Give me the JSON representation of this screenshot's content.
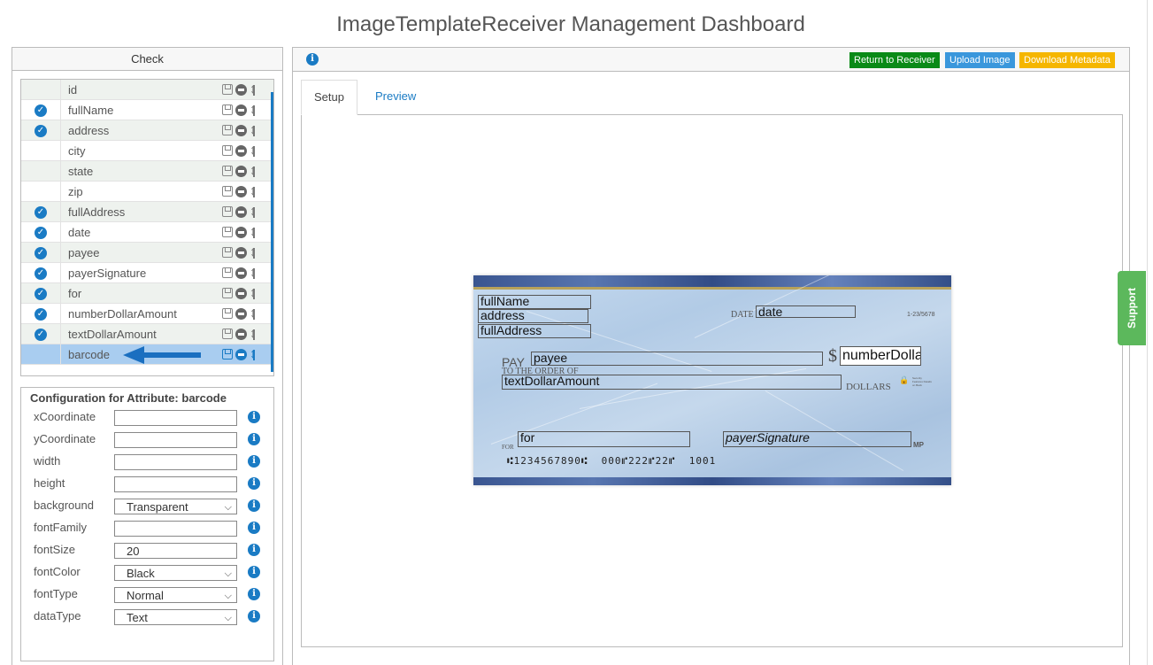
{
  "page": {
    "title": "ImageTemplateReceiver Management Dashboard"
  },
  "left_panel": {
    "header": "Check",
    "attributes": [
      {
        "name": "id",
        "checked": false
      },
      {
        "name": "fullName",
        "checked": true
      },
      {
        "name": "address",
        "checked": true
      },
      {
        "name": "city",
        "checked": false
      },
      {
        "name": "state",
        "checked": false
      },
      {
        "name": "zip",
        "checked": false
      },
      {
        "name": "fullAddress",
        "checked": true
      },
      {
        "name": "date",
        "checked": true
      },
      {
        "name": "payee",
        "checked": true
      },
      {
        "name": "payerSignature",
        "checked": true
      },
      {
        "name": "for",
        "checked": true
      },
      {
        "name": "numberDollarAmount",
        "checked": true
      },
      {
        "name": "textDollarAmount",
        "checked": true
      },
      {
        "name": "barcode",
        "checked": false,
        "selected": true
      }
    ],
    "config": {
      "title": "Configuration for Attribute: barcode",
      "fields": [
        {
          "label": "xCoordinate",
          "type": "input",
          "value": ""
        },
        {
          "label": "yCoordinate",
          "type": "input",
          "value": ""
        },
        {
          "label": "width",
          "type": "input",
          "value": ""
        },
        {
          "label": "height",
          "type": "input",
          "value": ""
        },
        {
          "label": "background",
          "type": "select",
          "value": "Transparent"
        },
        {
          "label": "fontFamily",
          "type": "input",
          "value": ""
        },
        {
          "label": "fontSize",
          "type": "input",
          "value": "20"
        },
        {
          "label": "fontColor",
          "type": "select",
          "value": "Black"
        },
        {
          "label": "fontType",
          "type": "select",
          "value": "Normal"
        },
        {
          "label": "dataType",
          "type": "select",
          "value": "Text"
        }
      ]
    }
  },
  "right_panel": {
    "buttons": {
      "return": "Return to Receiver",
      "upload": "Upload Image",
      "download": "Download Metadata"
    },
    "tabs": [
      {
        "label": "Setup",
        "active": true
      },
      {
        "label": "Preview",
        "active": false
      }
    ],
    "check": {
      "fields": {
        "fullName": "fullName",
        "address": "address",
        "fullAddress": "fullAddress",
        "date": "date",
        "payee": "payee",
        "numberDollarAmount": "numberDollarAmount",
        "textDollarAmount": "textDollarAmount",
        "for": "for",
        "payerSignature": "payerSignature"
      },
      "labels": {
        "date": "DATE",
        "routing": "1-23/5678",
        "pay": "PAY",
        "to_order": "TO THE ORDER OF",
        "dollar_sign": "$",
        "dollars": "DOLLARS",
        "security": "Security Features Details on Back",
        "for": "FOR",
        "mp": "MP"
      },
      "micr_line": "⑆1234567890⑆  000⑈222⑈22⑈  1001"
    }
  },
  "support": {
    "label": "Support"
  },
  "colors": {
    "accent": "#1a7bc4",
    "return_btn": "#0a8a17",
    "upload_btn": "#3a97dc",
    "download_btn": "#f5b600",
    "support": "#5cb85c"
  }
}
